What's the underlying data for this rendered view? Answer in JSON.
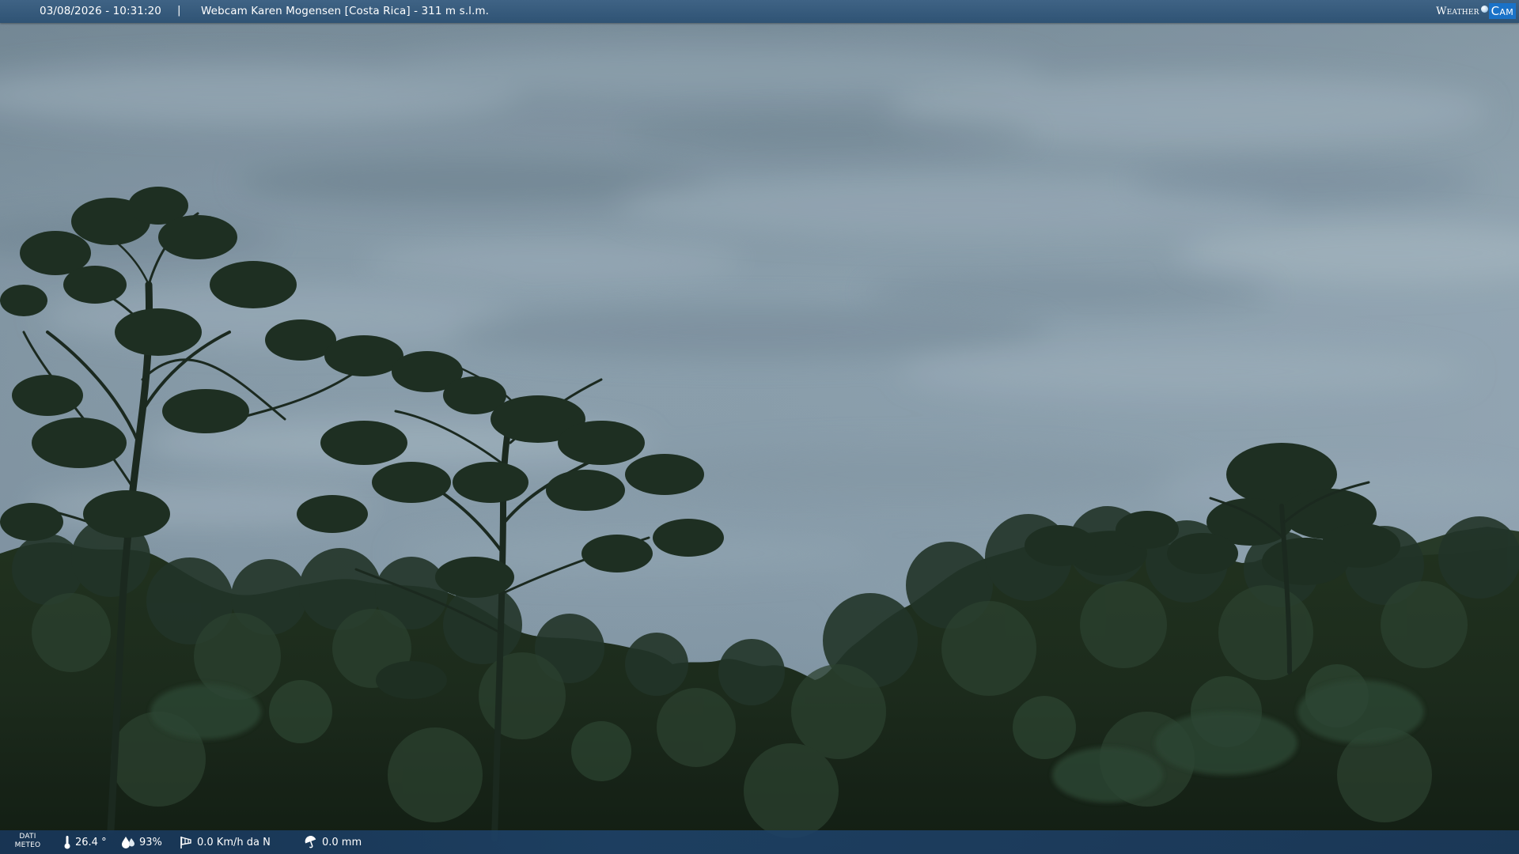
{
  "top_bar": {
    "timestamp": "03/08/2026 - 10:31:20",
    "separator": "|",
    "camera_title": "Webcam Karen Mogensen [Costa Rica]  - 311 m s.l.m.",
    "logo_weather": "Weather",
    "logo_cam": "Cam"
  },
  "weather_bar": {
    "label_line1": "DATI",
    "label_line2": "METEO",
    "temperature": "26.4 °",
    "temperature_icon": "thermometer-icon",
    "humidity": "93%",
    "humidity_icon": "water-drops-icon",
    "wind": "0.0 Km/h da N",
    "wind_icon": "windsock-icon",
    "rain": "0.0 mm",
    "rain_icon": "umbrella-icon"
  },
  "colors": {
    "top_bar": "#345a7c",
    "bottom_bar": "#1e4268",
    "logo_cam_bg": "#1a72c8",
    "sky": "#8fa3b2",
    "foliage": "#1e2e21"
  }
}
